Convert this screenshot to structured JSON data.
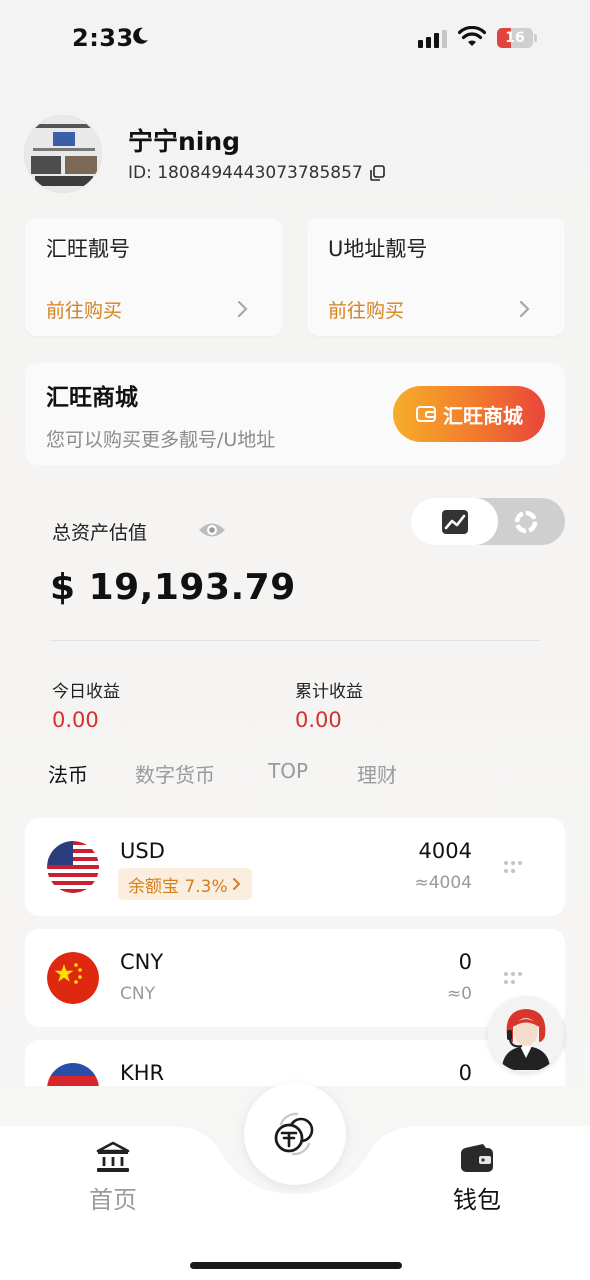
{
  "status_bar": {
    "time": "2:33",
    "battery": "16"
  },
  "profile": {
    "name": "宁宁ning",
    "id_text": "ID: 1808494443073785857"
  },
  "cards": [
    {
      "title": "汇旺靓号",
      "link": "前往购买"
    },
    {
      "title": "U地址靓号",
      "link": "前往购买"
    }
  ],
  "mall": {
    "title": "汇旺商城",
    "subtitle": "您可以购买更多靓号/U地址",
    "button": "汇旺商城"
  },
  "assets": {
    "label": "总资产估值",
    "value": "$ 19,193.79"
  },
  "earnings": {
    "today_label": "今日收益",
    "today_value": "0.00",
    "total_label": "累计收益",
    "total_value": "0.00"
  },
  "tabs": [
    "法币",
    "数字货币",
    "TOP",
    "理财"
  ],
  "currencies": [
    {
      "code": "USD",
      "amount": "4004",
      "approx": "≈4004",
      "badge": "余额宝 7.3%"
    },
    {
      "code": "CNY",
      "sub": "CNY",
      "amount": "0",
      "approx": "≈0"
    },
    {
      "code": "KHR",
      "amount": "0"
    }
  ],
  "nav": {
    "home": "首页",
    "wallet": "钱包"
  },
  "colors": {
    "accent_orange": "#d58320",
    "profit_red": "#d43030",
    "mall_gradient_start": "#f7ad2a",
    "mall_gradient_end": "#e9453a"
  }
}
